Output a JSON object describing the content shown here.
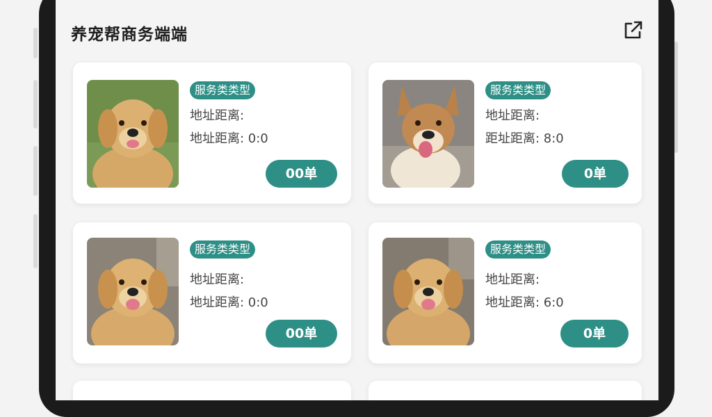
{
  "app": {
    "title": "养宠帮商务端端"
  },
  "icons": {
    "share": "external-link-icon"
  },
  "colors": {
    "accent": "#2e8f86",
    "background": "#f4f4f4"
  },
  "cards": [
    {
      "tag": "服务类类型",
      "line1": "地址距离:",
      "line2": "地址距离: 0:0",
      "button": "00单",
      "pet": "golden-retriever"
    },
    {
      "tag": "服务类类型",
      "line1": "地址距离:",
      "line2": "距址距离: 8:0",
      "button": "0单",
      "pet": "tan-mixed-dog"
    },
    {
      "tag": "服务类类型",
      "line1": "地址距离:",
      "line2": "地址距离: 0:0",
      "button": "00单",
      "pet": "golden-retriever"
    },
    {
      "tag": "服务类类型",
      "line1": "地址距离:",
      "line2": "地址距离: 6:0",
      "button": "0单",
      "pet": "golden-retriever"
    }
  ]
}
